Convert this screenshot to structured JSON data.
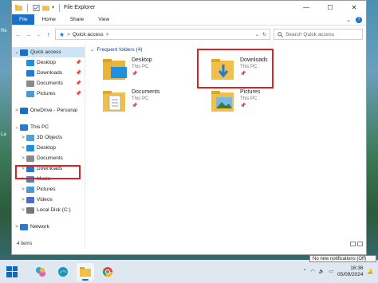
{
  "desktop": {
    "left_labels": [
      "Re",
      "La"
    ]
  },
  "window": {
    "title": "File Explorer",
    "controls": {
      "minimize": "—",
      "maximize": "☐",
      "close": "✕"
    }
  },
  "ribbon": {
    "tabs": [
      "File",
      "Home",
      "Share",
      "View"
    ],
    "expand": "⌄",
    "help": "?"
  },
  "address": {
    "path_root": "Quick access",
    "separator": ">",
    "search_placeholder": "Search Quick access"
  },
  "nav": {
    "items": [
      {
        "label": "Quick access",
        "icon": "star-icon",
        "chevron": "⌄",
        "level": 0,
        "pinned": false,
        "selected": true
      },
      {
        "label": "Desktop",
        "icon": "desktop-folder-icon",
        "level": 1,
        "pinned": true
      },
      {
        "label": "Downloads",
        "icon": "downloads-icon",
        "level": 1,
        "pinned": true
      },
      {
        "label": "Documents",
        "icon": "documents-icon",
        "level": 1,
        "pinned": true
      },
      {
        "label": "Pictures",
        "icon": "pictures-icon",
        "level": 1,
        "pinned": true
      },
      {
        "label": "",
        "level": 0,
        "spacer": true
      },
      {
        "label": "OneDrive - Personal",
        "icon": "onedrive-icon",
        "chevron": ">",
        "level": 0
      },
      {
        "label": "",
        "level": 0,
        "spacer": true
      },
      {
        "label": "This PC",
        "icon": "pc-icon",
        "chevron": "⌄",
        "level": 0
      },
      {
        "label": "3D Objects",
        "icon": "3d-objects-icon",
        "chevron": ">",
        "level": 1
      },
      {
        "label": "Desktop",
        "icon": "desktop-folder-icon",
        "chevron": ">",
        "level": 1
      },
      {
        "label": "Documents",
        "icon": "documents-icon",
        "chevron": ">",
        "level": 1
      },
      {
        "label": "Downloads",
        "icon": "downloads-icon",
        "chevron": ">",
        "level": 1
      },
      {
        "label": "Music",
        "icon": "music-icon",
        "chevron": ">",
        "level": 1
      },
      {
        "label": "Pictures",
        "icon": "pictures-icon",
        "chevron": ">",
        "level": 1
      },
      {
        "label": "Videos",
        "icon": "videos-icon",
        "chevron": ">",
        "level": 1
      },
      {
        "label": "Local Disk (C:)",
        "icon": "drive-icon",
        "chevron": ">",
        "level": 1
      },
      {
        "label": "",
        "level": 0,
        "spacer": true
      },
      {
        "label": "Network",
        "icon": "network-icon",
        "chevron": ">",
        "level": 0
      }
    ]
  },
  "main": {
    "group_header": "Frequent folders (4)",
    "folders": [
      {
        "name": "Desktop",
        "location": "This PC",
        "icon": "desktop-folder-icon"
      },
      {
        "name": "Downloads",
        "location": "This PC",
        "icon": "downloads-icon"
      },
      {
        "name": "Documents",
        "location": "This PC",
        "icon": "documents-icon"
      },
      {
        "name": "Pictures",
        "location": "This PC",
        "icon": "pictures-icon"
      }
    ]
  },
  "status": {
    "items": "4 items"
  },
  "taskbar": {
    "apps": [
      "start-icon",
      "copilot-icon",
      "edge-icon",
      "file-explorer-icon",
      "chrome-icon"
    ],
    "time": "16:36",
    "date": "05/09/2024",
    "notification": "No new notifications (Off)"
  },
  "colors": {
    "accent": "#1a6fc9",
    "highlight": "#d22222",
    "folder": "#f0c04a"
  }
}
